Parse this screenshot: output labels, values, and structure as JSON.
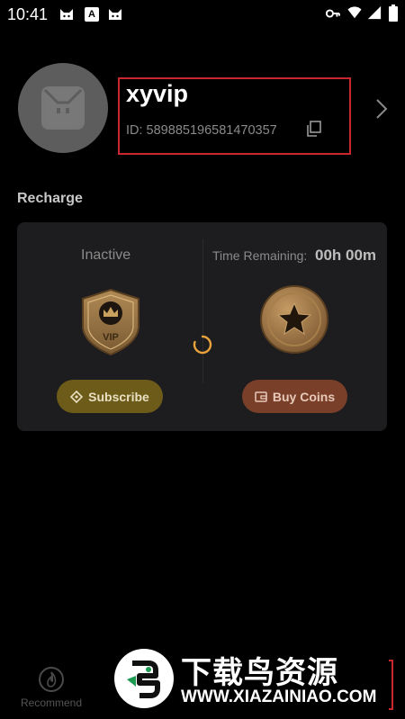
{
  "status_bar": {
    "time": "10:41",
    "icons": [
      "cat-icon",
      "a-icon",
      "cat-icon",
      "key-icon",
      "wifi-icon",
      "signal-icon",
      "battery-icon"
    ],
    "a_label": "A"
  },
  "profile": {
    "username": "xyvip",
    "id_text": "ID: 589885196581470357"
  },
  "recharge": {
    "title": "Recharge",
    "vip_status": "Inactive",
    "vip_badge_text": "VIP",
    "time_remaining_label": "Time Remaining:",
    "time_remaining_value": "00h 00m",
    "subscribe_label": "Subscribe",
    "buy_coins_label": "Buy Coins"
  },
  "bottom_nav": {
    "recommend_label": "Recommend"
  },
  "watermark": {
    "title": "下载鸟资源",
    "url": "WWW.XIAZAINIAO.COM"
  },
  "colors": {
    "background": "#000000",
    "card": "#1d1d1f",
    "subscribe_button": "#6d5b1a",
    "buy_coins_button": "#7a3f29",
    "highlight_border": "#c8272d",
    "spinner": "#e8a23c"
  }
}
